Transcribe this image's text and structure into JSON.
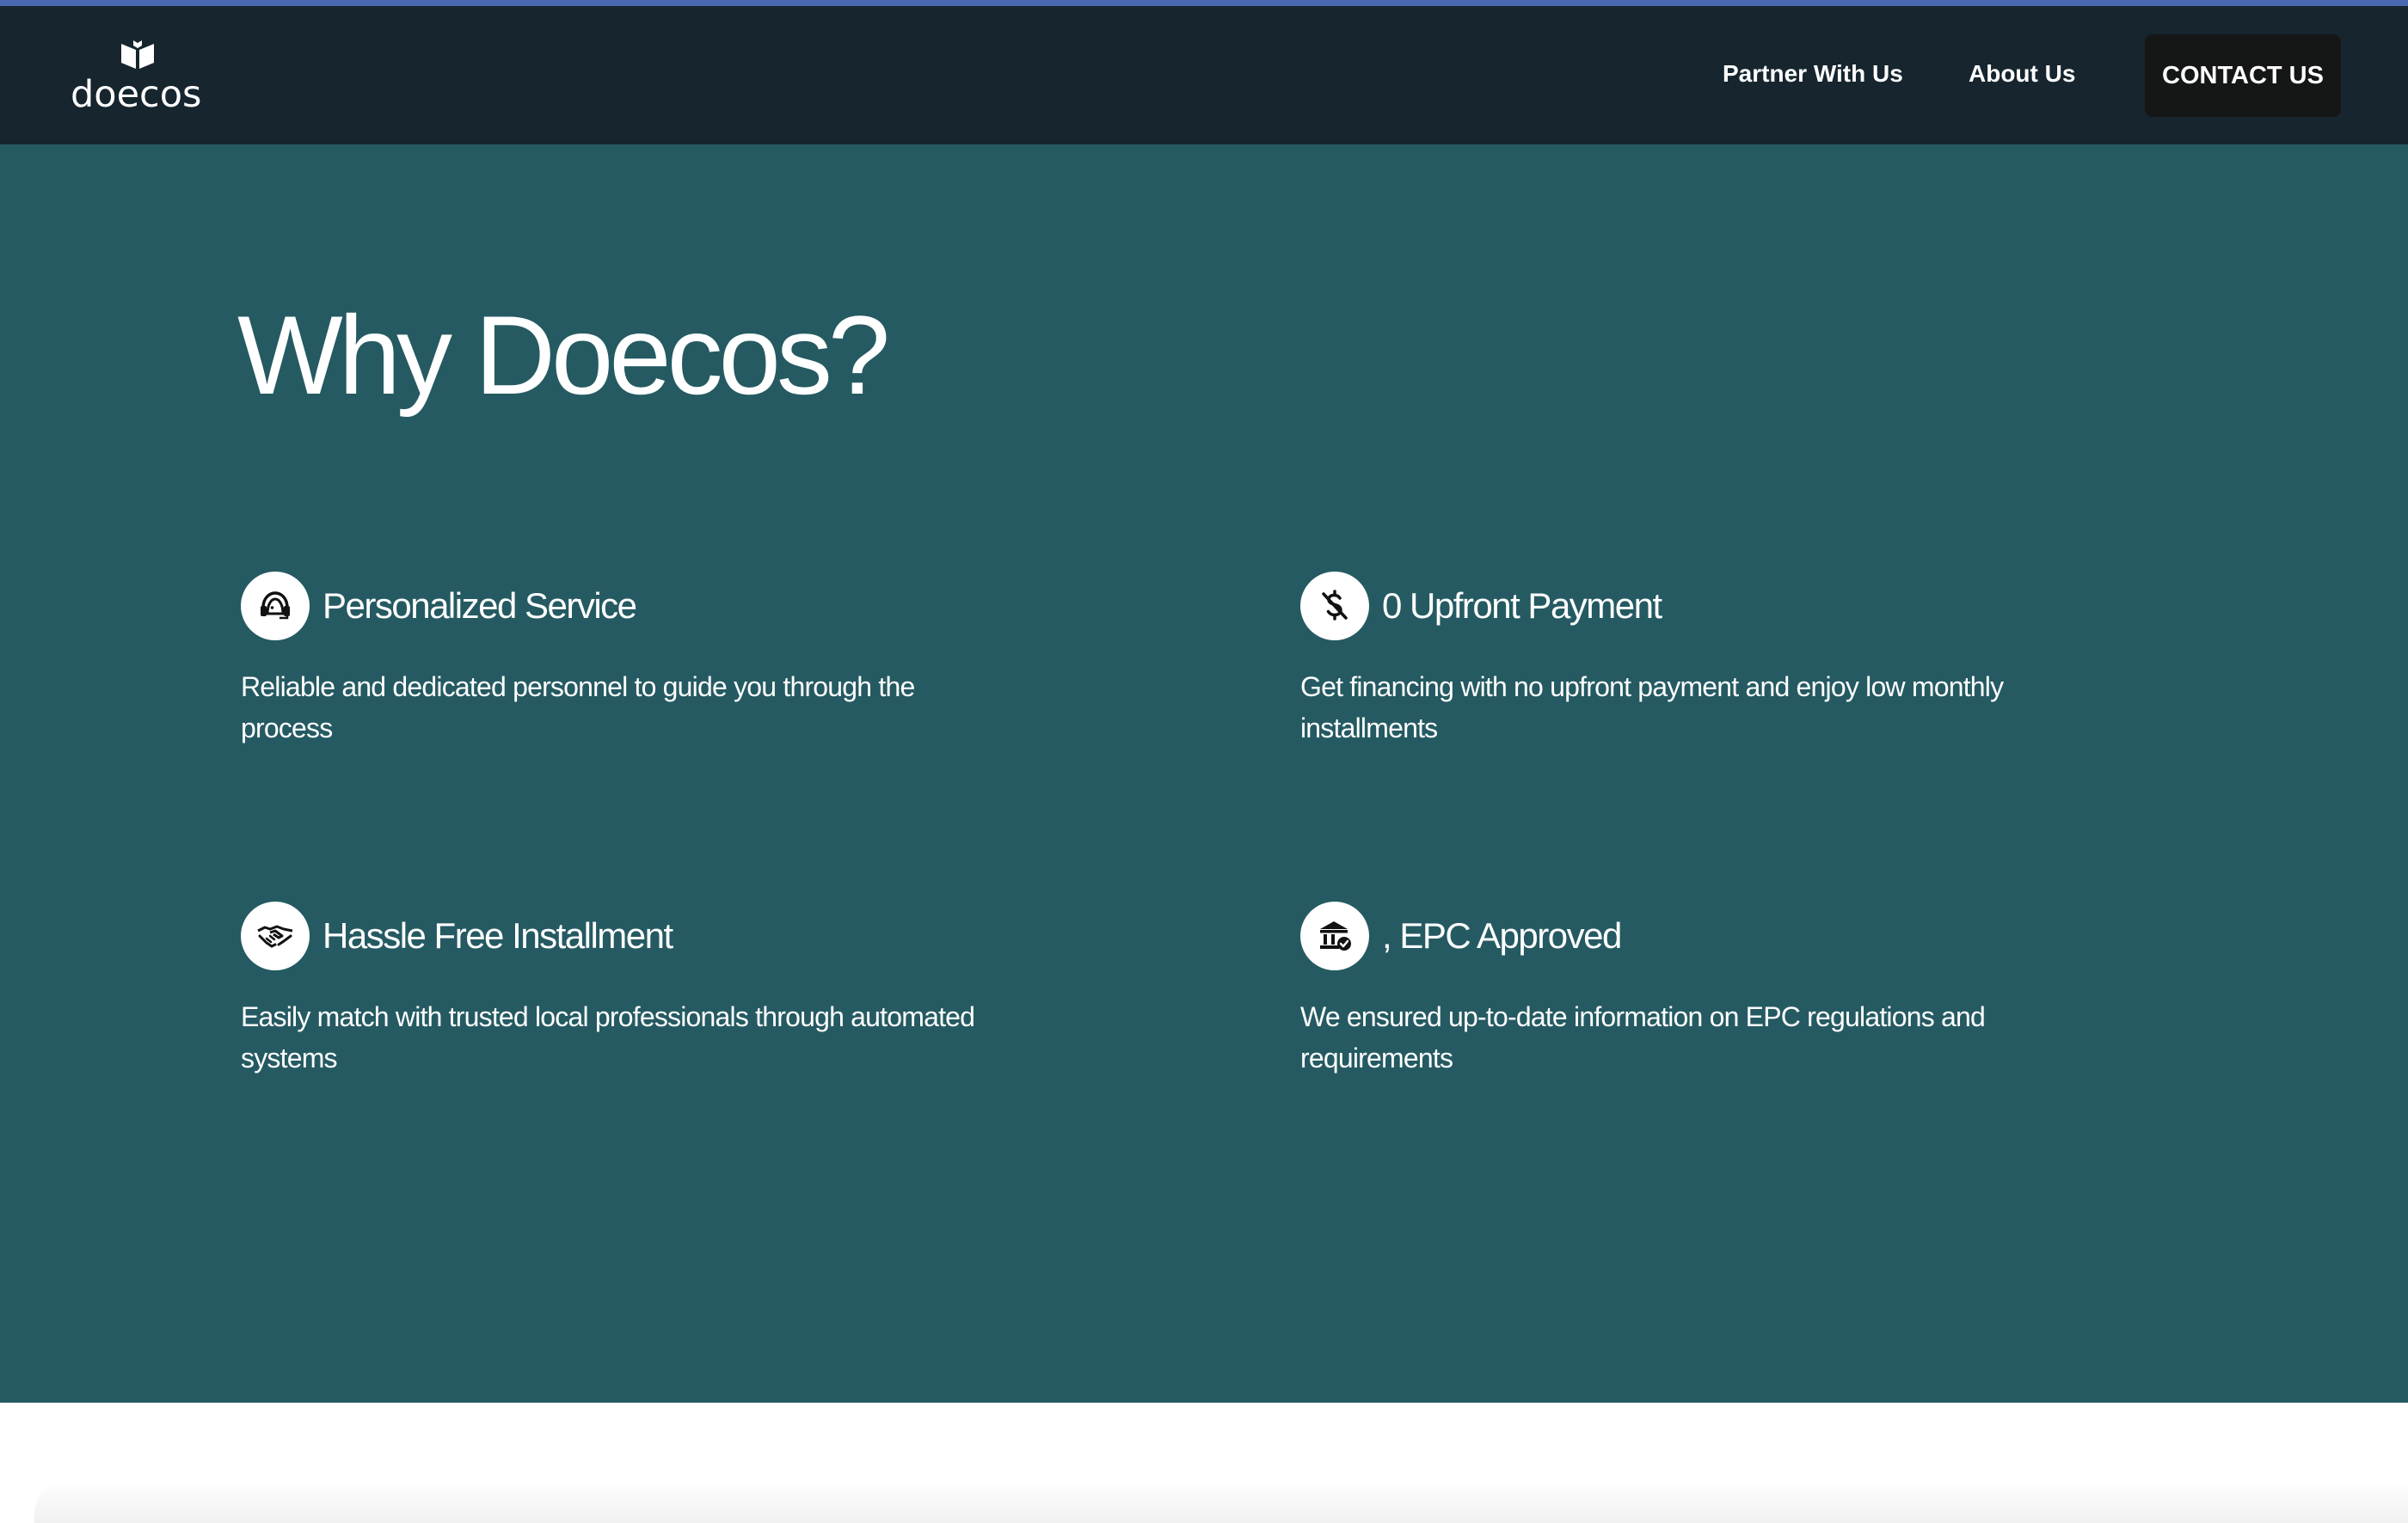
{
  "brand": {
    "name": "doecos"
  },
  "nav": {
    "links": [
      {
        "label": "Partner With Us"
      },
      {
        "label": "About Us"
      }
    ],
    "cta_label": "CONTACT US"
  },
  "hero": {
    "title": "Why Doecos?",
    "features": [
      {
        "icon": "headset-agent-icon",
        "title": "Personalized Service",
        "description": "Reliable and dedicated personnel to guide you through the process"
      },
      {
        "icon": "no-dollar-icon",
        "title": "0 Upfront Payment",
        "description": "Get financing with no upfront payment and enjoy low monthly installments"
      },
      {
        "icon": "handshake-icon",
        "title": "Hassle Free Installment",
        "description": "Easily match with trusted local professionals through automated systems"
      },
      {
        "icon": "bank-approved-icon",
        "title": ", EPC Approved",
        "description": "We ensured up-to-date information on EPC regulations and requirements"
      }
    ]
  },
  "colors": {
    "navbar_bg": "#16252e",
    "hero_bg": "#255a62",
    "cta_bg": "#151616",
    "top_stripe": "#4a69b0",
    "text": "#ffffff"
  }
}
